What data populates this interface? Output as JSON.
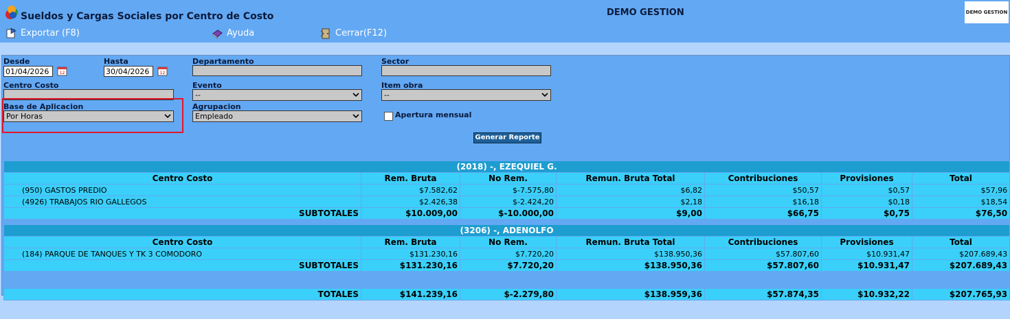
{
  "header": {
    "title": "Sueldos y Cargas Sociales por Centro de Costo",
    "company": "DEMO GESTION",
    "brand": "DEMO GESTION"
  },
  "toolbar": {
    "export_label": "Exportar (F8)",
    "help_label": "Ayuda",
    "close_label": "Cerrar(F12)"
  },
  "form": {
    "desde_label": "Desde",
    "desde_value": "01/04/2026",
    "hasta_label": "Hasta",
    "hasta_value": "30/04/2026",
    "departamento_label": "Departamento",
    "departamento_value": "",
    "sector_label": "Sector",
    "sector_value": "",
    "centro_costo_label": "Centro Costo",
    "centro_costo_value": "",
    "evento_label": "Evento",
    "evento_value": "--",
    "item_obra_label": "Item obra",
    "item_obra_value": "--",
    "base_label": "Base de Aplicacion",
    "base_value": "Por Horas",
    "agrupacion_label": "Agrupacion",
    "agrupacion_value": "Empleado",
    "apertura_label": "Apertura mensual",
    "generate_label": "Generar Reporte"
  },
  "report": {
    "columns": [
      "Centro Costo",
      "Rem. Bruta",
      "No Rem.",
      "Remun. Bruta Total",
      "Contribuciones",
      "Provisiones",
      "Total"
    ],
    "subtotal_label": "SUBTOTALES",
    "groups": [
      {
        "title": "(2018) -, EZEQUIEL G.",
        "rows": [
          [
            "(950) GASTOS PREDIO",
            "$7.582,62",
            "$-7.575,80",
            "$6,82",
            "$50,57",
            "$0,57",
            "$57,96"
          ],
          [
            "(4926) TRABAJOS RIO GALLEGOS",
            "$2.426,38",
            "$-2.424,20",
            "$2,18",
            "$16,18",
            "$0,18",
            "$18,54"
          ]
        ],
        "subtotals": [
          "$10.009,00",
          "$-10.000,00",
          "$9,00",
          "$66,75",
          "$0,75",
          "$76,50"
        ]
      },
      {
        "title": "(3206) -, ADENOLFO",
        "rows": [
          [
            "(184) PARQUE DE TANQUES Y TK 3 COMODORO",
            "$131.230,16",
            "$7.720,20",
            "$138.950,36",
            "$57.807,60",
            "$10.931,47",
            "$207.689,43"
          ]
        ],
        "subtotals": [
          "$131.230,16",
          "$7.720,20",
          "$138.950,36",
          "$57.807,60",
          "$10.931,47",
          "$207.689,43"
        ]
      }
    ],
    "totals_label": "TOTALES",
    "totals": [
      "$141.239,16",
      "$-2.279,80",
      "$138.959,36",
      "$57.874,35",
      "$10.932,22",
      "$207.765,93"
    ]
  },
  "colors": {
    "header_bg": "#63a8f3",
    "group_header": "#1d9dd0",
    "row_bg": "#3ad0f9",
    "highlight": "#e3162a",
    "button": "#1e5f97"
  }
}
